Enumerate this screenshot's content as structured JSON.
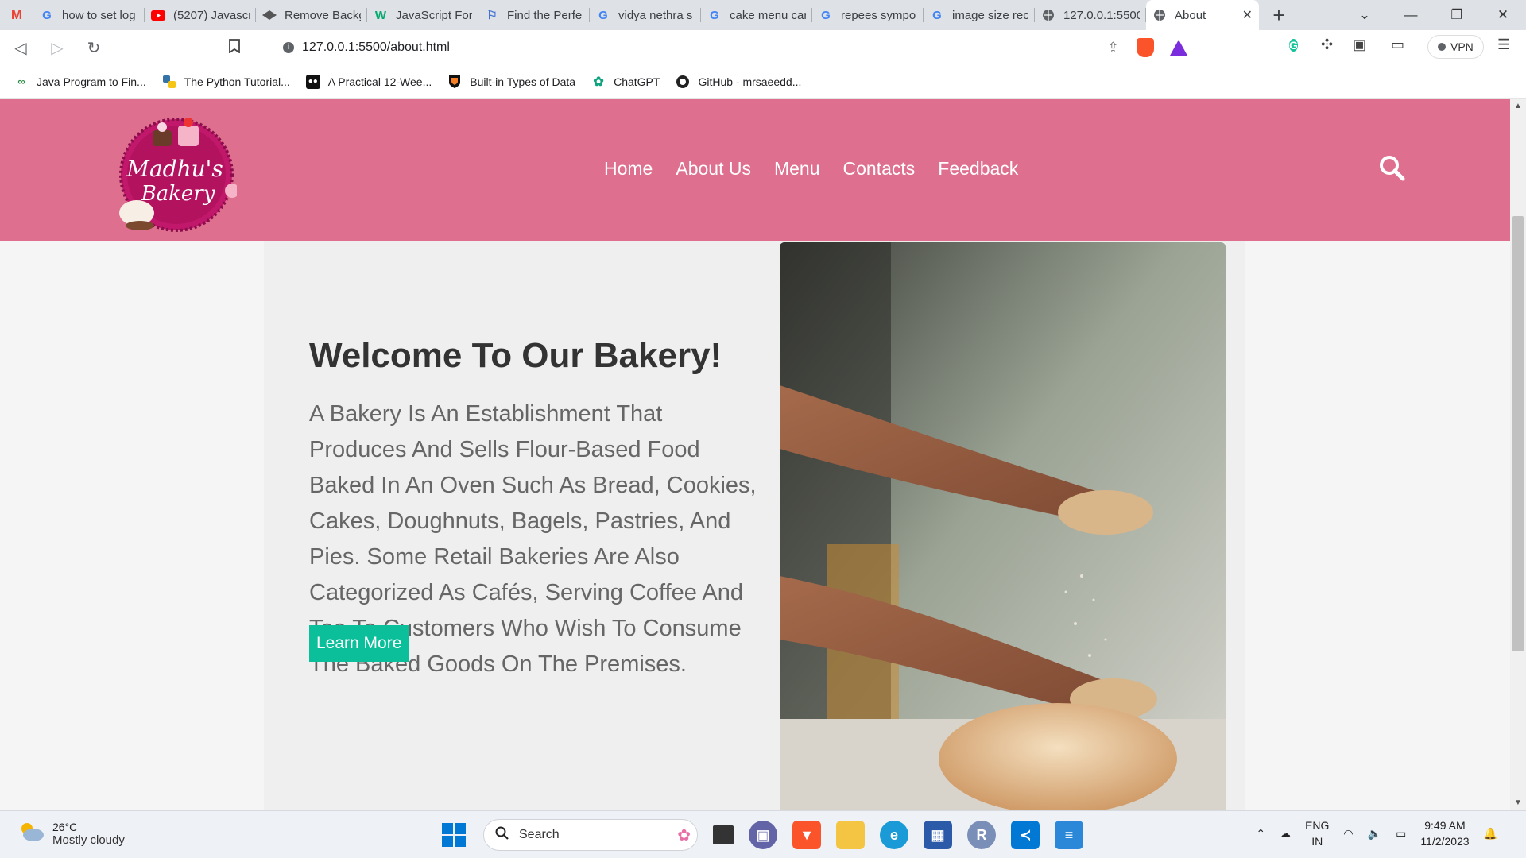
{
  "browser": {
    "tabs": [
      {
        "title": "",
        "icon": "gmail-icon"
      },
      {
        "title": "how to set log",
        "icon": "google-icon"
      },
      {
        "title": "(5207) Javascri",
        "icon": "youtube-icon"
      },
      {
        "title": "Remove Backg",
        "icon": "removebg-icon"
      },
      {
        "title": "JavaScript For",
        "icon": "w3-icon"
      },
      {
        "title": "Find the Perfe",
        "icon": "flag-icon"
      },
      {
        "title": "vidya nethra s",
        "icon": "google-icon"
      },
      {
        "title": "cake menu car",
        "icon": "google-icon"
      },
      {
        "title": "repees sympo",
        "icon": "google-icon"
      },
      {
        "title": "image size rec",
        "icon": "google-icon"
      },
      {
        "title": "127.0.0.1:5500",
        "icon": "globe-icon"
      },
      {
        "title": "About",
        "icon": "globe-icon",
        "active": true
      }
    ],
    "url": "127.0.0.1:5500/about.html",
    "vpn_label": "VPN",
    "bookmarks": [
      {
        "label": "Java Program to Fin...",
        "icon": "gfg-icon"
      },
      {
        "label": "The Python Tutorial...",
        "icon": "python-icon"
      },
      {
        "label": "A Practical 12-Wee...",
        "icon": "medium-icon"
      },
      {
        "label": "Built-in Types of Data",
        "icon": "princeton-icon"
      },
      {
        "label": "ChatGPT",
        "icon": "chatgpt-icon"
      },
      {
        "label": "GitHub - mrsaeedd...",
        "icon": "github-icon"
      }
    ]
  },
  "site": {
    "logo_text_line1": "Madhu's",
    "logo_text_line2": "Bakery",
    "nav": [
      "Home",
      "About Us",
      "Menu",
      "Contacts",
      "Feedback"
    ],
    "about": {
      "title": "Welcome To Our Bakery!",
      "body": "A Bakery Is An Establishment That Produces And Sells Flour-Based Food Baked In An Oven Such As Bread, Cookies, Cakes, Doughnuts, Bagels, Pastries, And Pies. Some Retail Bakeries Are Also Categorized As Cafés, Serving Coffee And Tea To Customers Who Wish To Consume The Baked Goods On The Premises.",
      "button": "Learn More"
    },
    "colors": {
      "header": "#df6f8f",
      "button": "#0bbf9a"
    }
  },
  "taskbar": {
    "temperature": "26°C",
    "weather": "Mostly cloudy",
    "search_label": "Search",
    "lang1": "ENG",
    "lang2": "IN",
    "time": "9:49 AM",
    "date": "11/2/2023"
  }
}
